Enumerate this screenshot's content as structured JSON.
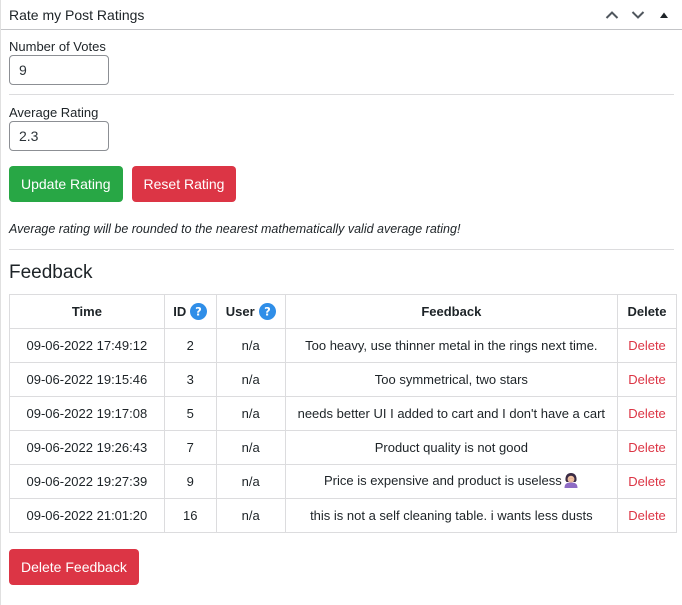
{
  "header": {
    "title": "Rate my Post Ratings"
  },
  "votes": {
    "label": "Number of Votes",
    "value": "9"
  },
  "average": {
    "label": "Average Rating",
    "value": "2.3"
  },
  "buttons": {
    "update": "Update Rating",
    "reset": "Reset Rating",
    "delete_feedback": "Delete Feedback"
  },
  "note": "Average rating will be rounded to the nearest mathematically valid average rating!",
  "feedback": {
    "title": "Feedback",
    "columns": {
      "time": "Time",
      "id": "ID",
      "user": "User",
      "feedback": "Feedback",
      "delete": "Delete"
    },
    "delete_label": "Delete",
    "rows": [
      {
        "time": "09-06-2022 17:49:12",
        "id": "2",
        "user": "n/a",
        "feedback": "Too heavy, use thinner metal in the rings next time."
      },
      {
        "time": "09-06-2022 19:15:46",
        "id": "3",
        "user": "n/a",
        "feedback": "Too symmetrical, two stars"
      },
      {
        "time": "09-06-2022 19:17:08",
        "id": "5",
        "user": "n/a",
        "feedback": "needs better UI I added to cart and I don't have a cart"
      },
      {
        "time": "09-06-2022 19:26:43",
        "id": "7",
        "user": "n/a",
        "feedback": "Product quality is not good"
      },
      {
        "time": "09-06-2022 19:27:39",
        "id": "9",
        "user": "n/a",
        "feedback": "Price is expensive and product is useless"
      },
      {
        "time": "09-06-2022 21:01:20",
        "id": "16",
        "user": "n/a",
        "feedback": "this is not a self cleaning table. i wants less dusts"
      }
    ]
  },
  "icons": {
    "move_up": "chevron-up-icon",
    "move_down": "chevron-down-icon",
    "toggle": "triangle-up-icon",
    "help": "question-circle-icon",
    "emoji": "woman-facepalming-emoji"
  },
  "colors": {
    "green": "#28a745",
    "red": "#dc3545",
    "help_blue": "#2f8ee8"
  }
}
